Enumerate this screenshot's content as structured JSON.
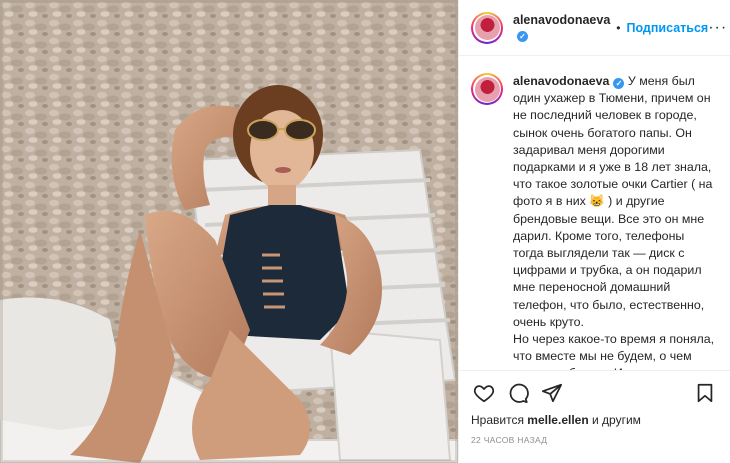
{
  "post": {
    "username": "alenavodonaeva",
    "verified_mark": "✓",
    "follow_label": "Подписаться",
    "dot": "•",
    "more_label": "···"
  },
  "caption": {
    "username": "alenavodonaeva",
    "text": "У меня был один ухажер в Тюмени, причем он не последний человек в городе, сынок очень богатого папы. Он задаривал меня дорогими подарками и я уже в 18 лет знала, что такое золотые очки Cartier ( на фото я в них 😸 ) и другие брендовые вещи. Все это он мне дарил. Кроме того, телефоны тогда выглядели так — диск с цифрами и трубка, а он подарил мне переносной домашний телефон, что было, естественно, очень круто.",
    "text2": "Но через какое-то время я поняла, что вместе мы не будем, о чем ему и сообщила. И тогда он приехал ко мне домой, с пистолетом в руке забирать все дорогие подарки и в их числе — переносной телефон. Я"
  },
  "likes": {
    "prefix": "Нравится ",
    "user": "melle.ellen",
    "suffix": " и другим"
  },
  "timestamp": "22 часов назад",
  "icons": {
    "like": "heart-icon",
    "comment": "comment-icon",
    "share": "share-icon",
    "save": "bookmark-icon"
  },
  "colors": {
    "accent": "#0095f6",
    "verified": "#3897f0",
    "text": "#262626",
    "muted": "#8e8e8e"
  }
}
